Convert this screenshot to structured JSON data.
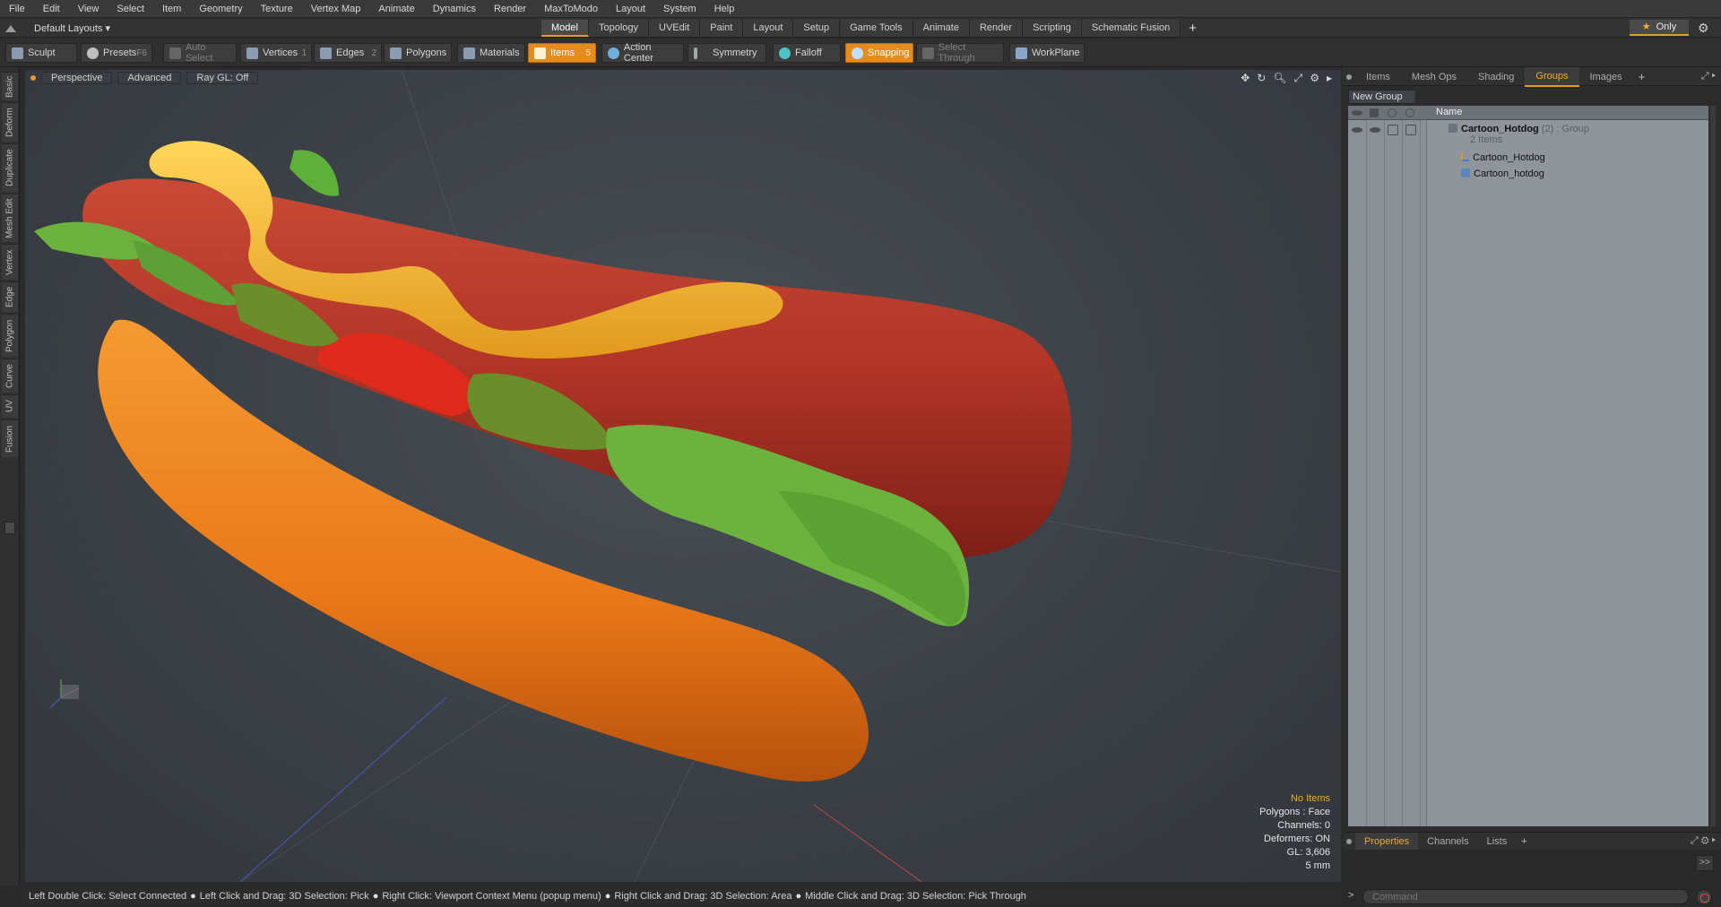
{
  "menu": [
    "File",
    "Edit",
    "View",
    "Select",
    "Item",
    "Geometry",
    "Texture",
    "Vertex Map",
    "Animate",
    "Dynamics",
    "Render",
    "MaxToModo",
    "Layout",
    "System",
    "Help"
  ],
  "layout_selector": "Default Layouts ▾",
  "layout_tabs": [
    {
      "label": "Model",
      "active": true
    },
    {
      "label": "Topology"
    },
    {
      "label": "UVEdit"
    },
    {
      "label": "Paint"
    },
    {
      "label": "Layout"
    },
    {
      "label": "Setup"
    },
    {
      "label": "Game Tools"
    },
    {
      "label": "Animate"
    },
    {
      "label": "Render"
    },
    {
      "label": "Scripting"
    },
    {
      "label": "Schematic Fusion"
    }
  ],
  "layout_plus": "+",
  "only_label": "Only",
  "toolbar": {
    "sculpt": "Sculpt",
    "presets": "Presets",
    "presets_key": "F6",
    "auto_select": "Auto Select",
    "vertices": "Vertices",
    "vertices_key": "1",
    "edges": "Edges",
    "edges_key": "2",
    "polygons": "Polygons",
    "materials": "Materials",
    "items": "Items",
    "items_key": "5",
    "action_center": "Action Center",
    "symmetry": "Symmetry",
    "falloff": "Falloff",
    "snapping": "Snapping",
    "select_through": "Select Through",
    "workplane": "WorkPlane"
  },
  "left_tabs": [
    "Basic",
    "Deform",
    "Duplicate",
    "Mesh Edit",
    "Vertex",
    "Edge",
    "Polygon",
    "Curve",
    "UV",
    "Fusion"
  ],
  "viewport": {
    "view": "Perspective",
    "shading": "Advanced",
    "raygl": "Ray GL: Off",
    "hud": {
      "no_items": "No Items",
      "polygons": "Polygons : Face",
      "channels": "Channels: 0",
      "deformers": "Deformers: ON",
      "gl": "GL: 3,606",
      "scale": "5 mm"
    }
  },
  "status_bar": [
    "Left Double Click: Select Connected",
    "Left Click and Drag: 3D Selection: Pick",
    "Right Click: Viewport Context Menu (popup menu)",
    "Right Click and Drag: 3D Selection: Area",
    "Middle Click and Drag: 3D Selection: Pick Through"
  ],
  "right_panel": {
    "tabs": [
      {
        "label": "Items"
      },
      {
        "label": "Mesh Ops"
      },
      {
        "label": "Shading"
      },
      {
        "label": "Groups",
        "active": true
      },
      {
        "label": "Images"
      }
    ],
    "plus": "+",
    "new_group": "New Group",
    "column_name": "Name",
    "group": {
      "name": "Cartoon_Hotdog",
      "count": "(2)",
      "type": ": Group",
      "items_label": "2 Items",
      "children": [
        "Cartoon_Hotdog",
        "Cartoon_hotdog"
      ]
    },
    "bottom_tabs": [
      {
        "label": "Properties",
        "active": true
      },
      {
        "label": "Channels"
      },
      {
        "label": "Lists"
      }
    ],
    "command_placeholder": "Command",
    "prompt": ">"
  },
  "colors": {
    "accent": "#e9962b",
    "sausage": "#b8352a",
    "bun": "#f08a25",
    "mustard": "#f0b830",
    "lettuce": "#6cb23e",
    "tomato": "#e02a1c"
  }
}
